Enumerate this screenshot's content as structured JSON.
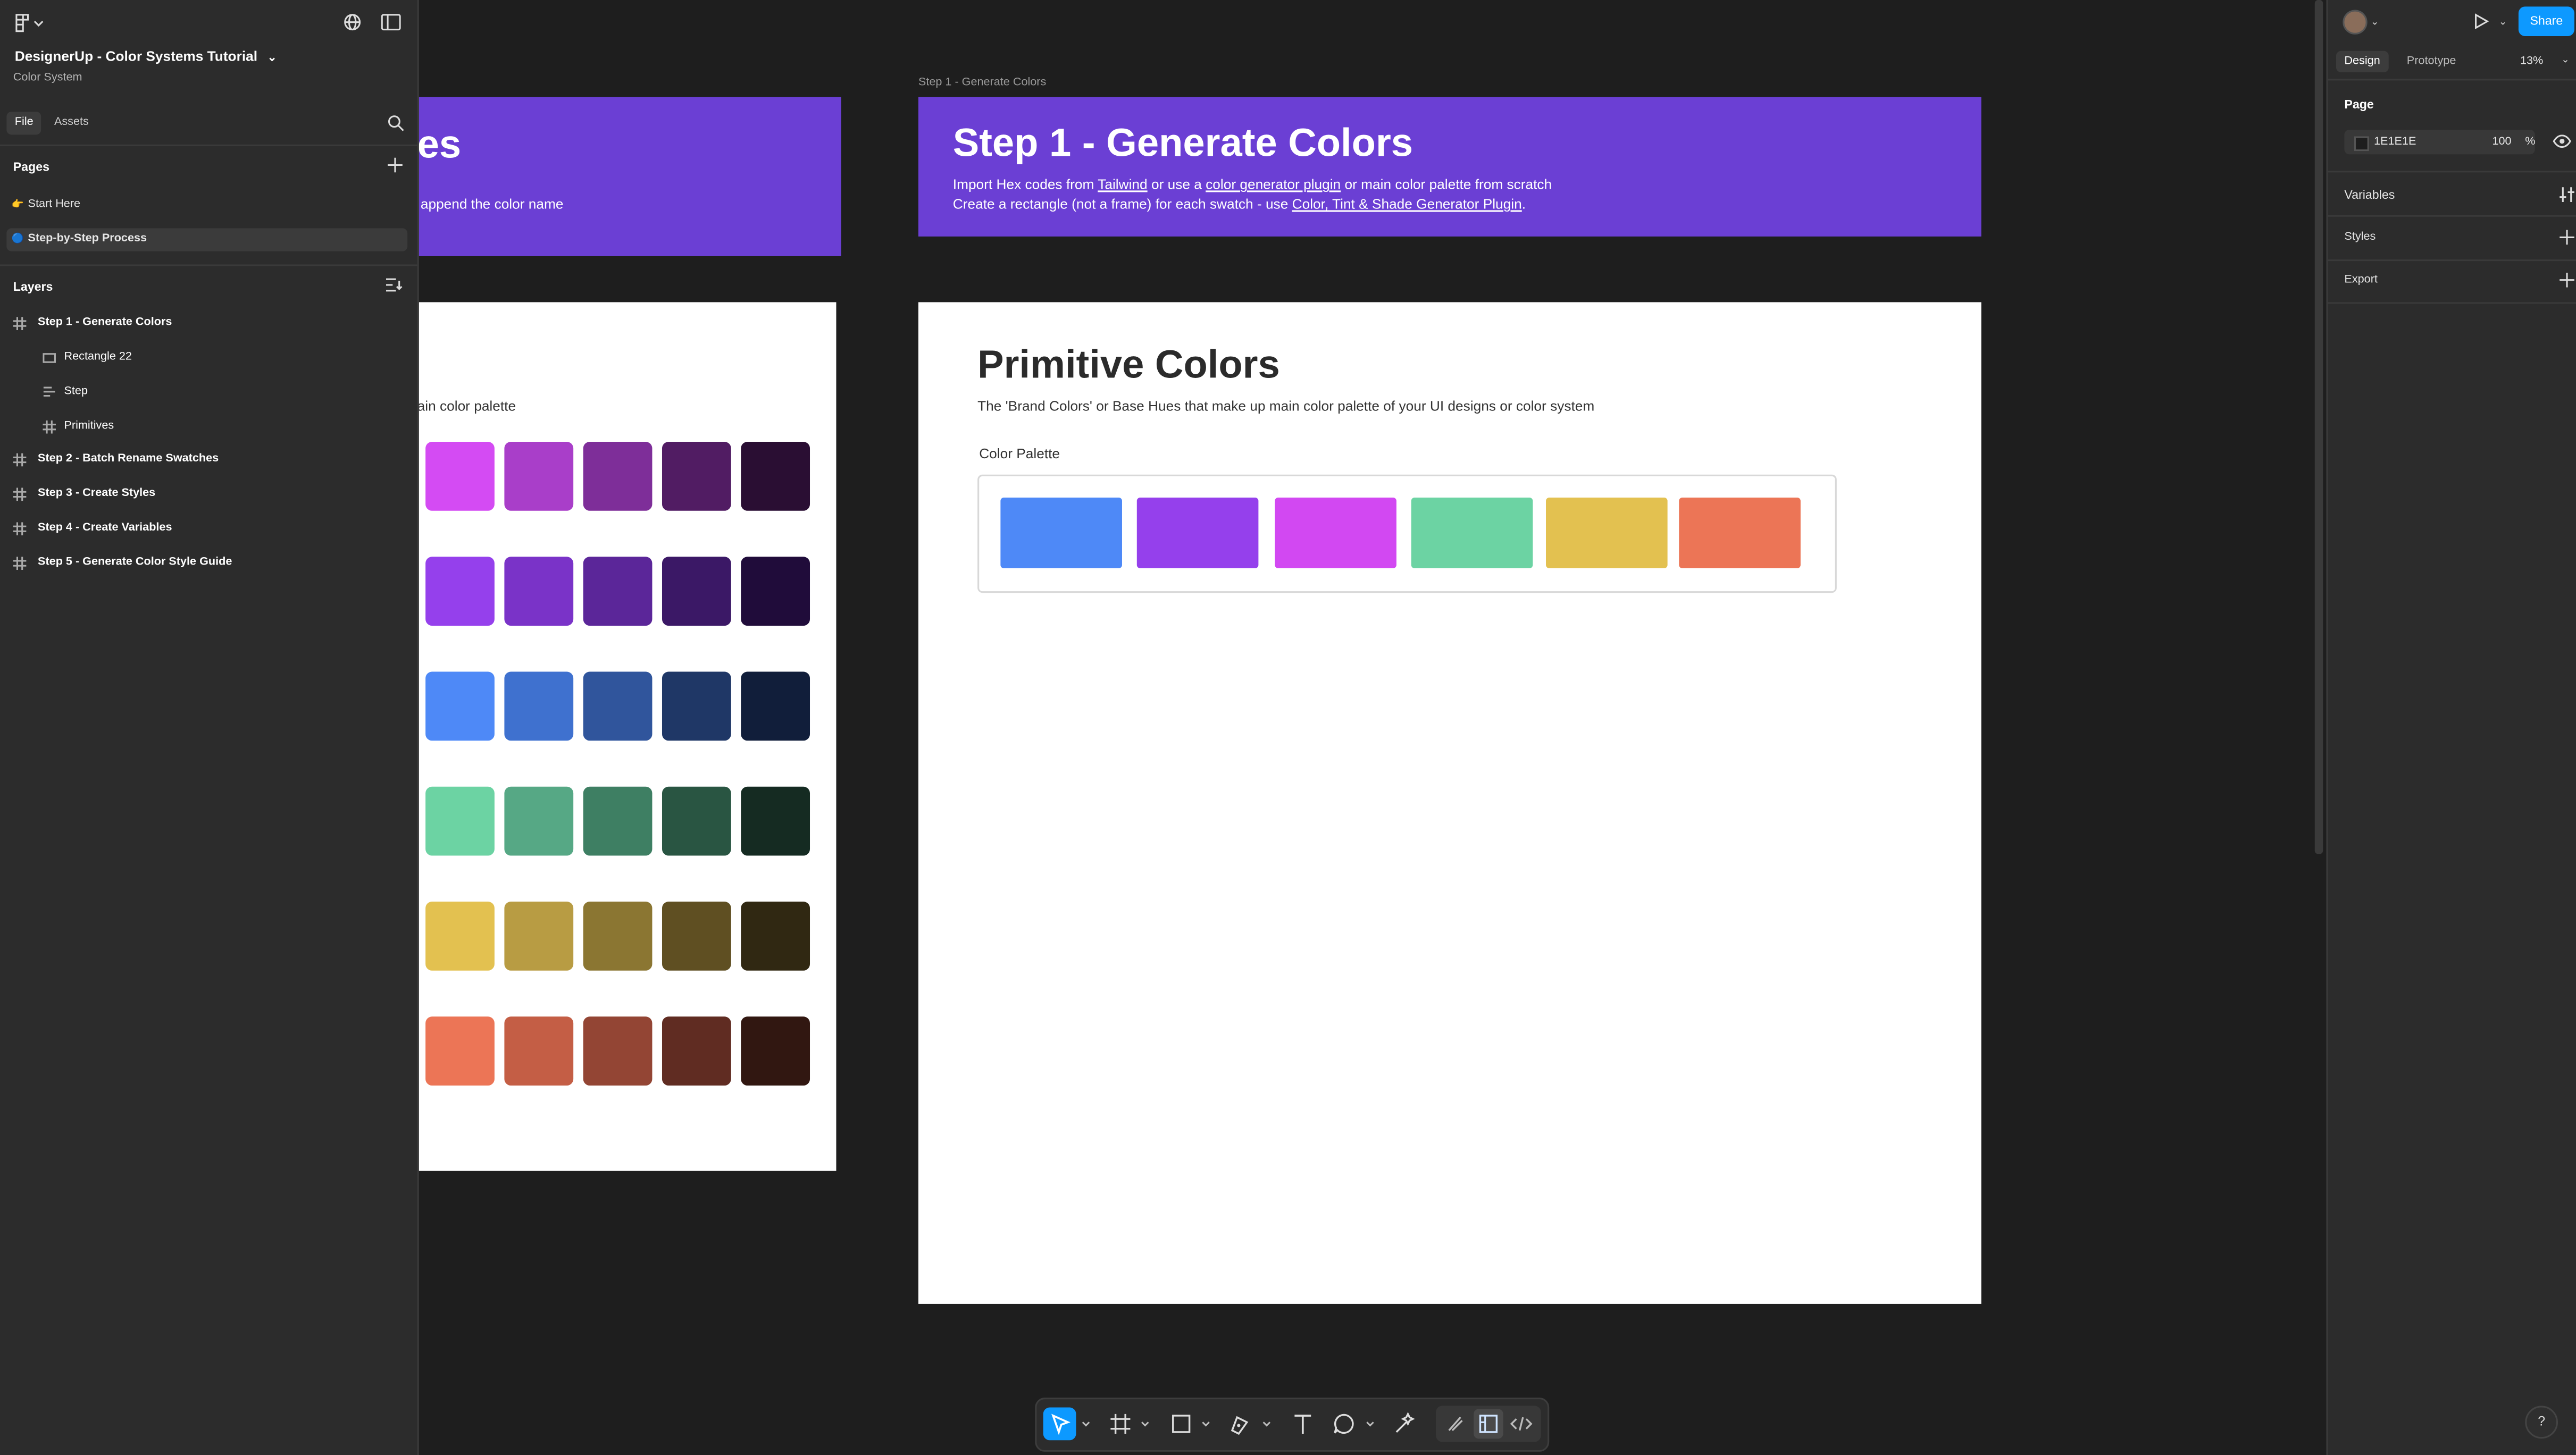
{
  "file": {
    "title": "DesignerUp - Color Systems Tutorial",
    "subtitle": "Color System"
  },
  "left_tabs": [
    "File",
    "Assets"
  ],
  "pages": {
    "label": "Pages",
    "items": [
      {
        "emoji": "👉",
        "label": "Start Here"
      },
      {
        "emoji": "🔵",
        "label": "Step-by-Step Process"
      }
    ]
  },
  "layers": {
    "label": "Layers",
    "items": [
      {
        "label": "Step 1 - Generate Colors",
        "kind": "frame"
      },
      {
        "label": "Rectangle 22",
        "kind": "rect"
      },
      {
        "label": "Step",
        "kind": "text-component"
      },
      {
        "label": "Primitives",
        "kind": "frame"
      },
      {
        "label": "Step 2 - Batch Rename Swatches",
        "kind": "frame"
      },
      {
        "label": "Step 3 - Create Styles",
        "kind": "frame"
      },
      {
        "label": "Step 4 - Create Variables",
        "kind": "frame"
      },
      {
        "label": "Step 5 - Generate Color Style Guide",
        "kind": "frame"
      }
    ]
  },
  "right": {
    "share": "Share",
    "tabs": [
      "Design",
      "Prototype"
    ],
    "zoom": "13%",
    "page_label": "Page",
    "page_color": "1E1E1E",
    "page_opacity": "100",
    "percent": "%",
    "sections": [
      "Variables",
      "Styles",
      "Export"
    ]
  },
  "canvas": {
    "frame_label": "Step 1 - Generate Colors",
    "left_banner_title": "es",
    "left_banner_text": "append the color name",
    "left_panel_text": "ain color palette",
    "step1_title": "Step 1 - Generate Colors",
    "step1_line1": {
      "a": "Import Hex codes from ",
      "link1": "Tailwind",
      "b": " or use a ",
      "link2": "color generator plugin",
      "c": " or main color palette from scratch"
    },
    "step1_line2": {
      "a": "Create a rectangle (not a frame) for each swatch - use ",
      "link": "Color, Tint & Shade Generator Plugin",
      "b": "."
    },
    "primitive_title": "Primitive Colors",
    "primitive_desc": "The 'Brand Colors' or Base Hues that make up main color palette of your UI designs or color system",
    "palette_label": "Color Palette",
    "palette": [
      "#4e89f7",
      "#9540ec",
      "#d248f2",
      "#6cd3a3",
      "#e3c150",
      "#ec7556"
    ],
    "swatch_rows": [
      [
        "#d44bf3",
        "#a93ec9",
        "#7e2e99",
        "#511c63",
        "#2a0e33"
      ],
      [
        "#9540ec",
        "#7a33c8",
        "#5b2699",
        "#3b1866",
        "#200c3a"
      ],
      [
        "#4e89f7",
        "#3f71cf",
        "#30559c",
        "#1f3766",
        "#111e3a"
      ],
      [
        "#6cd3a3",
        "#56a885",
        "#3e7f63",
        "#295542",
        "#152b22"
      ],
      [
        "#e3c150",
        "#b89c43",
        "#8b7632",
        "#5f4f22",
        "#302812"
      ],
      [
        "#ec7556",
        "#c45e45",
        "#934534",
        "#602c22",
        "#311711"
      ]
    ]
  },
  "toolbar_icons": [
    "move-tool",
    "frame-tool",
    "shape-tool",
    "pen-tool",
    "text-tool",
    "comment-tool",
    "actions-tool",
    "draw-mode",
    "design-mode",
    "dev-mode"
  ]
}
